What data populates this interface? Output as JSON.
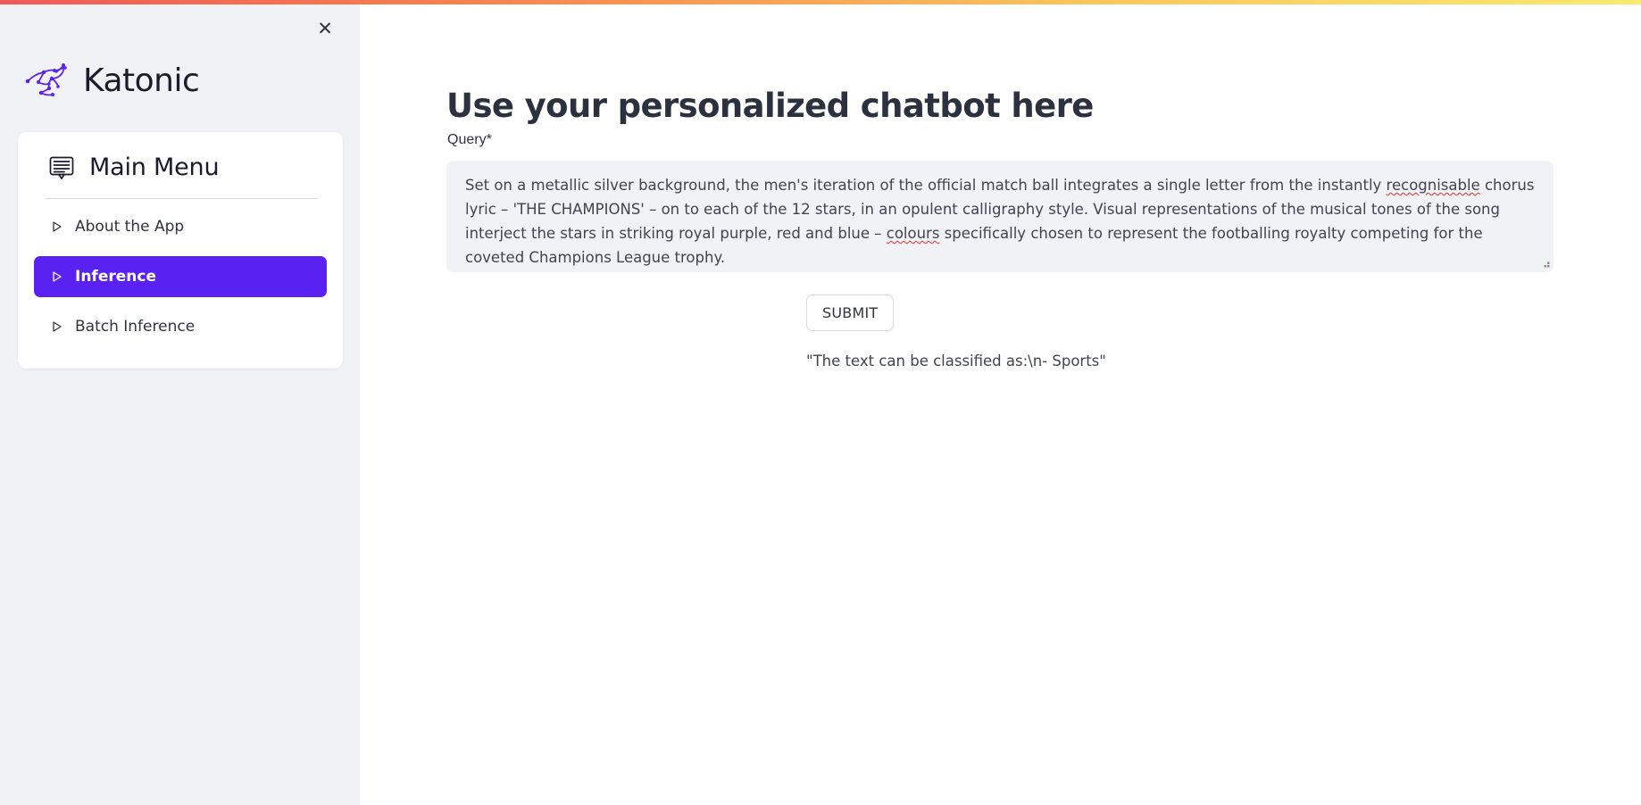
{
  "theme": {
    "accent": "#5a22f0",
    "sidebar_bg": "#f0f2f6",
    "input_bg": "#f0f2f6",
    "title_color": "#2b313e",
    "gradient_from": "#f05a5a",
    "gradient_to": "#f9e96d",
    "spellcheck_underline": "#e03030"
  },
  "sidebar": {
    "close_label": "✕",
    "brand": "Katonic",
    "menu": {
      "title": "Main Menu",
      "icon": "chat-menu-icon"
    },
    "items": [
      {
        "label": "About the App",
        "active": false,
        "icon": "caret-right-icon"
      },
      {
        "label": "Inference",
        "active": true,
        "icon": "caret-right-icon"
      },
      {
        "label": "Batch Inference",
        "active": false,
        "icon": "caret-right-icon"
      }
    ]
  },
  "main": {
    "title": "Use your personalized chatbot here",
    "query": {
      "label": "Query",
      "required_mark": "*",
      "segments": [
        {
          "text": "Set on a metallic silver background, the men's iteration of the official match ball integrates a single letter from the instantly ",
          "misspelled": false
        },
        {
          "text": "recognisable",
          "misspelled": true
        },
        {
          "text": " chorus lyric – 'THE CHAMPIONS' – on to each of the 12 stars, in an opulent calligraphy style. Visual representations of the musical tones of the song interject the stars in striking royal purple, red and blue – ",
          "misspelled": false
        },
        {
          "text": "colours",
          "misspelled": true
        },
        {
          "text": " specifically chosen to represent the footballing royalty competing for the coveted Champions League trophy.",
          "misspelled": false
        }
      ],
      "value": "Set on a metallic silver background, the men's iteration of the official match ball integrates a single letter from the instantly recognisable chorus lyric – 'THE CHAMPIONS' – on to each of the 12 stars, in an opulent calligraphy style. Visual representations of the musical tones of the song interject the stars in striking royal purple, red and blue – colours specifically chosen to represent the footballing royalty competing for the coveted Champions League trophy.",
      "placeholder": ""
    },
    "submit_label": "SUBMIT",
    "result": "\"The text can be classified as:\\n- Sports\""
  }
}
